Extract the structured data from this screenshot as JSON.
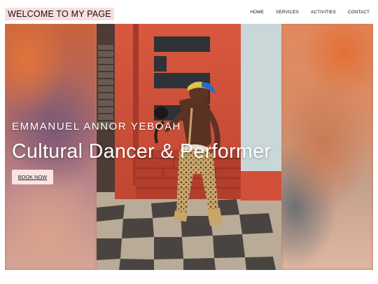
{
  "header": {
    "logo_text": "WELCOME TO MY PAGE",
    "nav": [
      {
        "label": "HOME"
      },
      {
        "label": "SERVICES"
      },
      {
        "label": "ACTIVITIES"
      },
      {
        "label": "CONTACT"
      }
    ]
  },
  "hero": {
    "subtitle": "EMMANUEL ANNOR YEBOAH",
    "title": "Cultural Dancer & Performer",
    "cta_label": "BOOK NOW"
  },
  "colors": {
    "logo_bg": "#f9dede",
    "button_bg": "#fbe3e3",
    "wall_red": "#c94b36",
    "text_white": "#ffffff"
  }
}
